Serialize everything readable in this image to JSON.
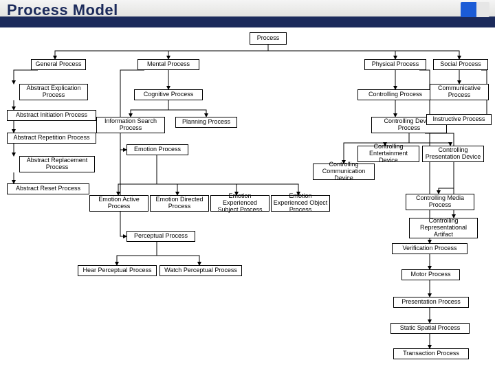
{
  "title": "Process Model",
  "footer": "",
  "nodes": {
    "root": "Process",
    "general": "General Process",
    "mental": "Mental Process",
    "physical": "Physical Process",
    "social": "Social Process",
    "absExplication": "Abstract Explication Process",
    "absInitiation": "Abstract Initiation Process",
    "absRepetition": "Abstract Repetition Process",
    "absReplacement": "Abstract Replacement Process",
    "absReset": "Abstract Reset Process",
    "cognitive": "Cognitive Process",
    "infoSearch": "Information Search Process",
    "planning": "Planning Process",
    "emotion": "Emotion Process",
    "emoActive": "Emotion Active Process",
    "emoDirected": "Emotion Directed Process",
    "emoExpSubj": "Emotion Experienced Subject Process",
    "emoExpObj": "Emotion Experienced Object Process",
    "perceptual": "Perceptual Process",
    "hearPerc": "Hear Perceptual Process",
    "watchPerc": "Watch Perceptual Process",
    "controlling": "Controlling Process",
    "ctrlDevice": "Controlling Device Process",
    "ctrlComm": "Controlling Communication Device",
    "ctrlEntertain": "Controlling Entertainment Device",
    "ctrlPresent": "Controlling Presentation Device",
    "ctrlMedia": "Controlling Media Process",
    "ctrlRepArt": "Controlling Representational Artifact",
    "verification": "Verification Process",
    "motor": "Motor Process",
    "presentation": "Presentation Process",
    "staticSpatial": "Static Spatial Process",
    "transaction": "Transaction Process",
    "communicative": "Communicative Process",
    "instructive": "Instructive Process"
  }
}
